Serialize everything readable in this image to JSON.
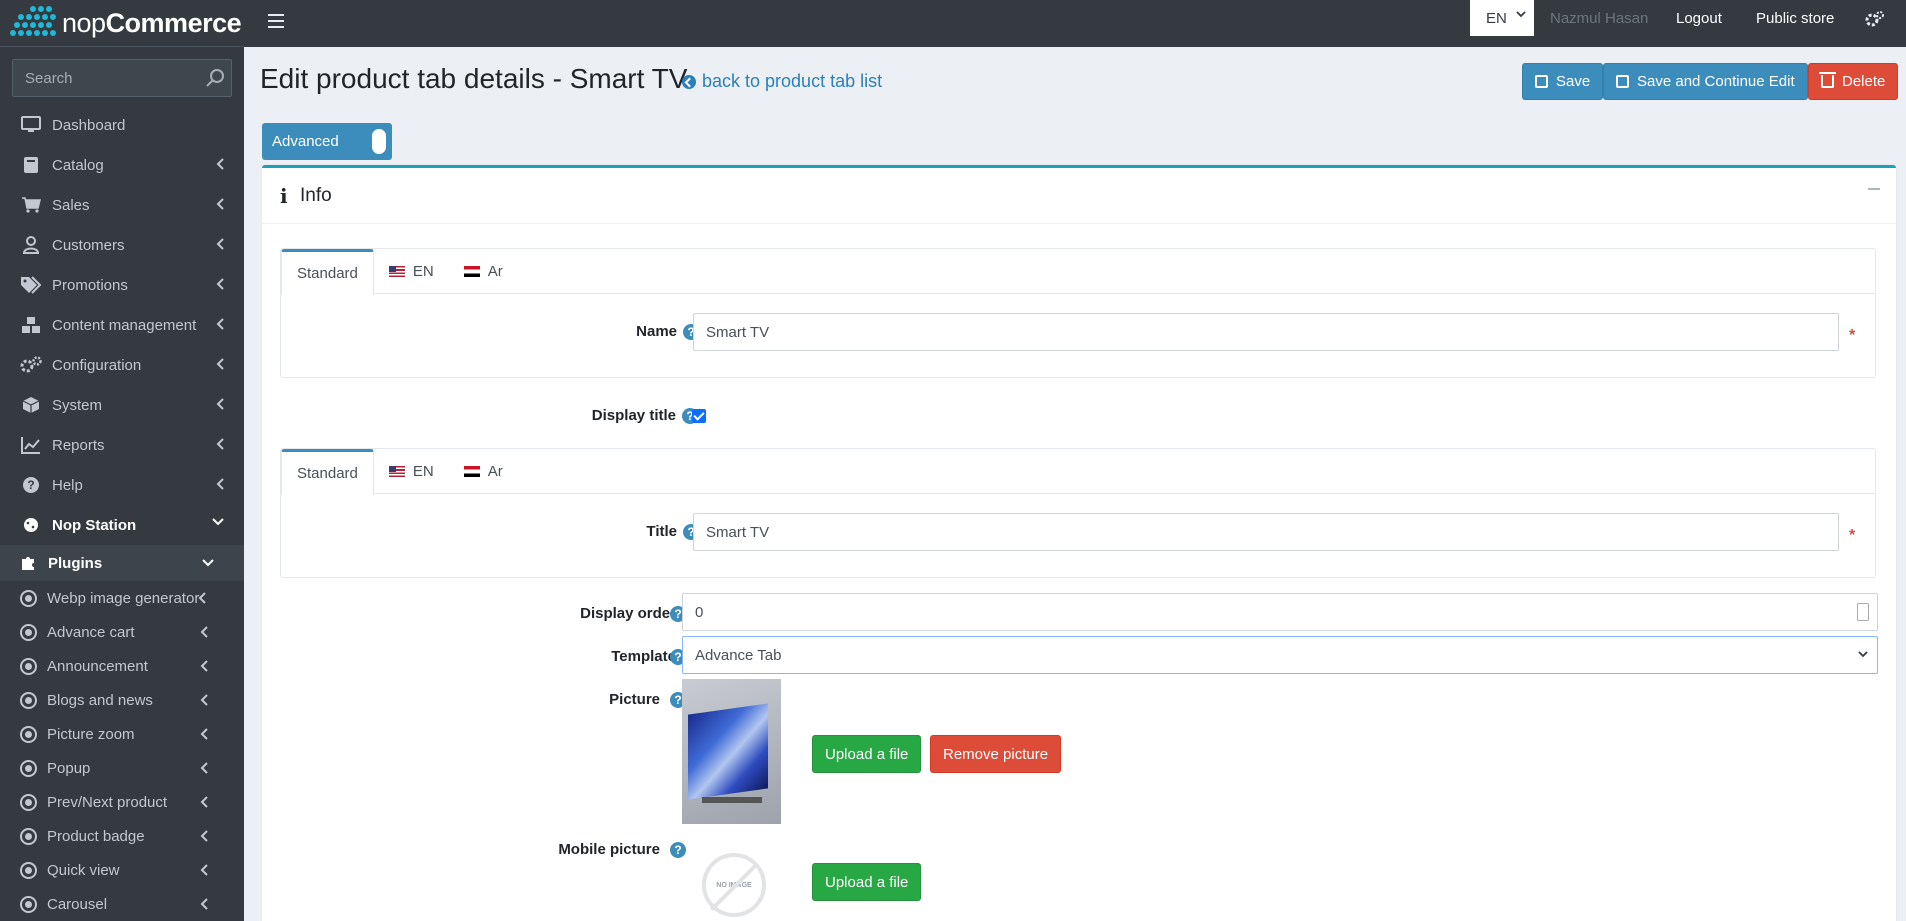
{
  "brand": {
    "name_light": "nop",
    "name_bold": "Commerce"
  },
  "sidebar": {
    "search_placeholder": "Search",
    "items": [
      {
        "label": "Dashboard",
        "icon": "monitor-icon"
      },
      {
        "label": "Catalog",
        "icon": "book-icon"
      },
      {
        "label": "Sales",
        "icon": "cart-icon"
      },
      {
        "label": "Customers",
        "icon": "user-icon"
      },
      {
        "label": "Promotions",
        "icon": "tags-icon"
      },
      {
        "label": "Content management",
        "icon": "cubes-icon"
      },
      {
        "label": "Configuration",
        "icon": "gears-icon"
      },
      {
        "label": "System",
        "icon": "cube-icon"
      },
      {
        "label": "Reports",
        "icon": "chart-icon"
      },
      {
        "label": "Help",
        "icon": "question-icon"
      },
      {
        "label": "Nop Station",
        "icon": "cookie-icon"
      }
    ],
    "plugins_label": "Plugins",
    "plugin_items": [
      "Webp image generator",
      "Advance cart",
      "Announcement",
      "Blogs and news",
      "Picture zoom",
      "Popup",
      "Prev/Next product",
      "Product badge",
      "Quick view",
      "Carousel"
    ]
  },
  "topbar": {
    "language": "EN",
    "user_name": "Nazmul Hasan",
    "logout": "Logout",
    "public_store": "Public store"
  },
  "page": {
    "title": "Edit product tab details - Smart TV",
    "back_link": "back to product tab list",
    "buttons": {
      "save": "Save",
      "save_continue": "Save and Continue Edit",
      "delete": "Delete"
    },
    "advanced_toggle": "Advanced"
  },
  "card": {
    "title": "Info",
    "tabs": [
      "Standard",
      "EN",
      "Ar"
    ],
    "name_label": "Name",
    "name_value": "Smart TV",
    "display_title_label": "Display title",
    "display_title_checked": true,
    "title_label": "Title",
    "title_value": "Smart TV",
    "display_order_label": "Display order",
    "display_order_value": "0",
    "template_label": "Template",
    "template_value": "Advance Tab",
    "picture_label": "Picture",
    "upload_label": "Upload a file",
    "remove_picture_label": "Remove picture",
    "mobile_picture_label": "Mobile picture",
    "no_image_text": "NO IMAGE",
    "required_mark": "*",
    "help_mark": "?"
  },
  "colors": {
    "primary": "#3c8dbc",
    "danger": "#dd4b39",
    "success": "#28a745",
    "sidebar_bg": "#343a40",
    "card_accent": "#17a2b8"
  }
}
